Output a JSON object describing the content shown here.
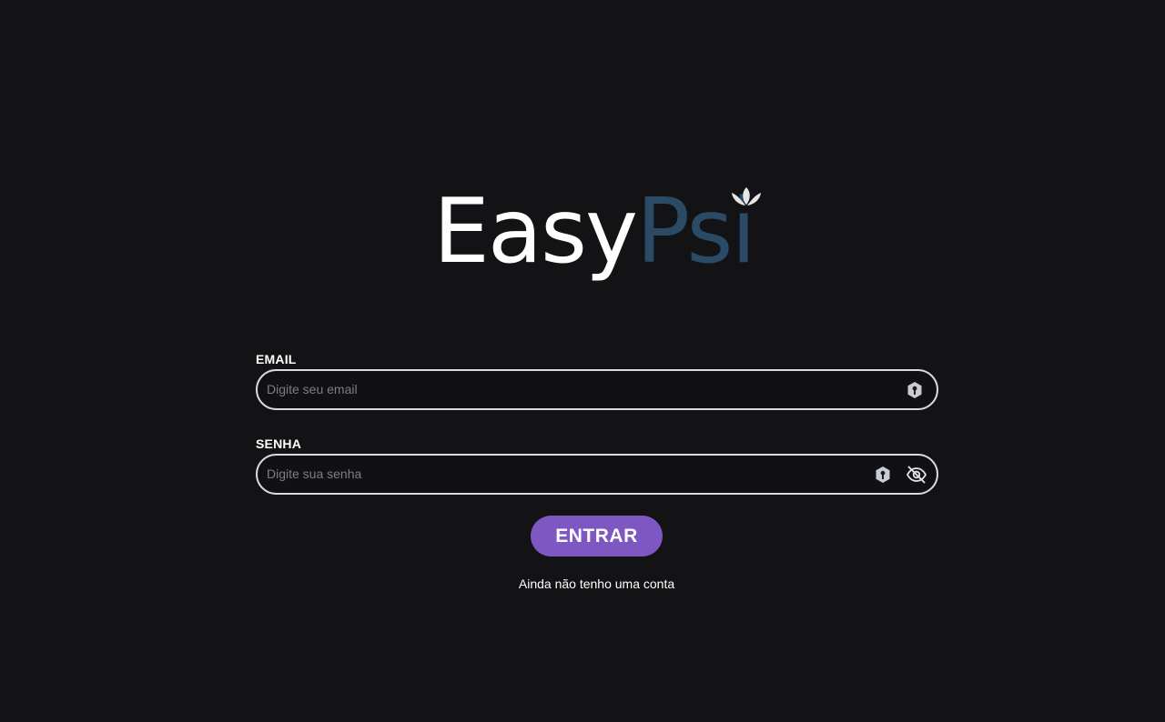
{
  "logo": {
    "part1": "Easy",
    "part2": "Psi",
    "color_part1": "#ffffff",
    "color_part2": "#2b4a66",
    "icon": "lotus-icon"
  },
  "form": {
    "email": {
      "label": "EMAIL",
      "placeholder": "Digite seu email",
      "value": "",
      "icon": "password-manager-key-icon"
    },
    "password": {
      "label": "SENHA",
      "placeholder": "Digite sua senha",
      "value": "",
      "icons": [
        "password-manager-key-icon",
        "eye-off-icon"
      ]
    },
    "submit_label": "ENTRAR",
    "submit_color": "#7e57c2",
    "signup_link": "Ainda não tenho uma conta"
  },
  "colors": {
    "background": "#131316",
    "input_border": "#d9d9de",
    "placeholder": "#7d7d85"
  }
}
